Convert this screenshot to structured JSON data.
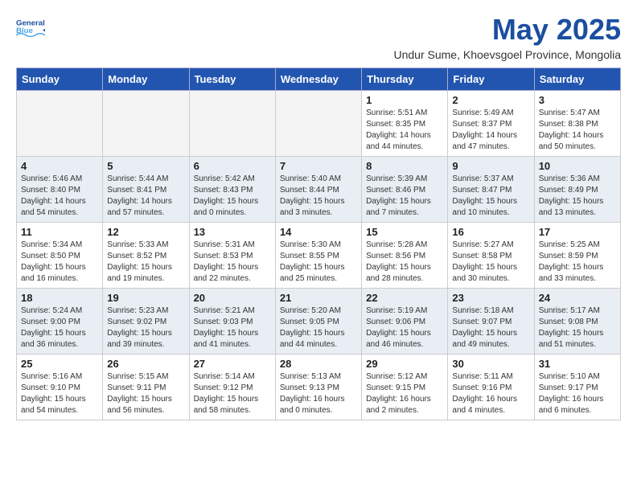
{
  "header": {
    "logo_general": "General",
    "logo_blue": "Blue",
    "month_title": "May 2025",
    "subtitle": "Undur Sume, Khoevsgoel Province, Mongolia"
  },
  "days_of_week": [
    "Sunday",
    "Monday",
    "Tuesday",
    "Wednesday",
    "Thursday",
    "Friday",
    "Saturday"
  ],
  "weeks": [
    [
      {
        "num": "",
        "info": ""
      },
      {
        "num": "",
        "info": ""
      },
      {
        "num": "",
        "info": ""
      },
      {
        "num": "",
        "info": ""
      },
      {
        "num": "1",
        "info": "Sunrise: 5:51 AM\nSunset: 8:35 PM\nDaylight: 14 hours\nand 44 minutes."
      },
      {
        "num": "2",
        "info": "Sunrise: 5:49 AM\nSunset: 8:37 PM\nDaylight: 14 hours\nand 47 minutes."
      },
      {
        "num": "3",
        "info": "Sunrise: 5:47 AM\nSunset: 8:38 PM\nDaylight: 14 hours\nand 50 minutes."
      }
    ],
    [
      {
        "num": "4",
        "info": "Sunrise: 5:46 AM\nSunset: 8:40 PM\nDaylight: 14 hours\nand 54 minutes."
      },
      {
        "num": "5",
        "info": "Sunrise: 5:44 AM\nSunset: 8:41 PM\nDaylight: 14 hours\nand 57 minutes."
      },
      {
        "num": "6",
        "info": "Sunrise: 5:42 AM\nSunset: 8:43 PM\nDaylight: 15 hours\nand 0 minutes."
      },
      {
        "num": "7",
        "info": "Sunrise: 5:40 AM\nSunset: 8:44 PM\nDaylight: 15 hours\nand 3 minutes."
      },
      {
        "num": "8",
        "info": "Sunrise: 5:39 AM\nSunset: 8:46 PM\nDaylight: 15 hours\nand 7 minutes."
      },
      {
        "num": "9",
        "info": "Sunrise: 5:37 AM\nSunset: 8:47 PM\nDaylight: 15 hours\nand 10 minutes."
      },
      {
        "num": "10",
        "info": "Sunrise: 5:36 AM\nSunset: 8:49 PM\nDaylight: 15 hours\nand 13 minutes."
      }
    ],
    [
      {
        "num": "11",
        "info": "Sunrise: 5:34 AM\nSunset: 8:50 PM\nDaylight: 15 hours\nand 16 minutes."
      },
      {
        "num": "12",
        "info": "Sunrise: 5:33 AM\nSunset: 8:52 PM\nDaylight: 15 hours\nand 19 minutes."
      },
      {
        "num": "13",
        "info": "Sunrise: 5:31 AM\nSunset: 8:53 PM\nDaylight: 15 hours\nand 22 minutes."
      },
      {
        "num": "14",
        "info": "Sunrise: 5:30 AM\nSunset: 8:55 PM\nDaylight: 15 hours\nand 25 minutes."
      },
      {
        "num": "15",
        "info": "Sunrise: 5:28 AM\nSunset: 8:56 PM\nDaylight: 15 hours\nand 28 minutes."
      },
      {
        "num": "16",
        "info": "Sunrise: 5:27 AM\nSunset: 8:58 PM\nDaylight: 15 hours\nand 30 minutes."
      },
      {
        "num": "17",
        "info": "Sunrise: 5:25 AM\nSunset: 8:59 PM\nDaylight: 15 hours\nand 33 minutes."
      }
    ],
    [
      {
        "num": "18",
        "info": "Sunrise: 5:24 AM\nSunset: 9:00 PM\nDaylight: 15 hours\nand 36 minutes."
      },
      {
        "num": "19",
        "info": "Sunrise: 5:23 AM\nSunset: 9:02 PM\nDaylight: 15 hours\nand 39 minutes."
      },
      {
        "num": "20",
        "info": "Sunrise: 5:21 AM\nSunset: 9:03 PM\nDaylight: 15 hours\nand 41 minutes."
      },
      {
        "num": "21",
        "info": "Sunrise: 5:20 AM\nSunset: 9:05 PM\nDaylight: 15 hours\nand 44 minutes."
      },
      {
        "num": "22",
        "info": "Sunrise: 5:19 AM\nSunset: 9:06 PM\nDaylight: 15 hours\nand 46 minutes."
      },
      {
        "num": "23",
        "info": "Sunrise: 5:18 AM\nSunset: 9:07 PM\nDaylight: 15 hours\nand 49 minutes."
      },
      {
        "num": "24",
        "info": "Sunrise: 5:17 AM\nSunset: 9:08 PM\nDaylight: 15 hours\nand 51 minutes."
      }
    ],
    [
      {
        "num": "25",
        "info": "Sunrise: 5:16 AM\nSunset: 9:10 PM\nDaylight: 15 hours\nand 54 minutes."
      },
      {
        "num": "26",
        "info": "Sunrise: 5:15 AM\nSunset: 9:11 PM\nDaylight: 15 hours\nand 56 minutes."
      },
      {
        "num": "27",
        "info": "Sunrise: 5:14 AM\nSunset: 9:12 PM\nDaylight: 15 hours\nand 58 minutes."
      },
      {
        "num": "28",
        "info": "Sunrise: 5:13 AM\nSunset: 9:13 PM\nDaylight: 16 hours\nand 0 minutes."
      },
      {
        "num": "29",
        "info": "Sunrise: 5:12 AM\nSunset: 9:15 PM\nDaylight: 16 hours\nand 2 minutes."
      },
      {
        "num": "30",
        "info": "Sunrise: 5:11 AM\nSunset: 9:16 PM\nDaylight: 16 hours\nand 4 minutes."
      },
      {
        "num": "31",
        "info": "Sunrise: 5:10 AM\nSunset: 9:17 PM\nDaylight: 16 hours\nand 6 minutes."
      }
    ]
  ]
}
